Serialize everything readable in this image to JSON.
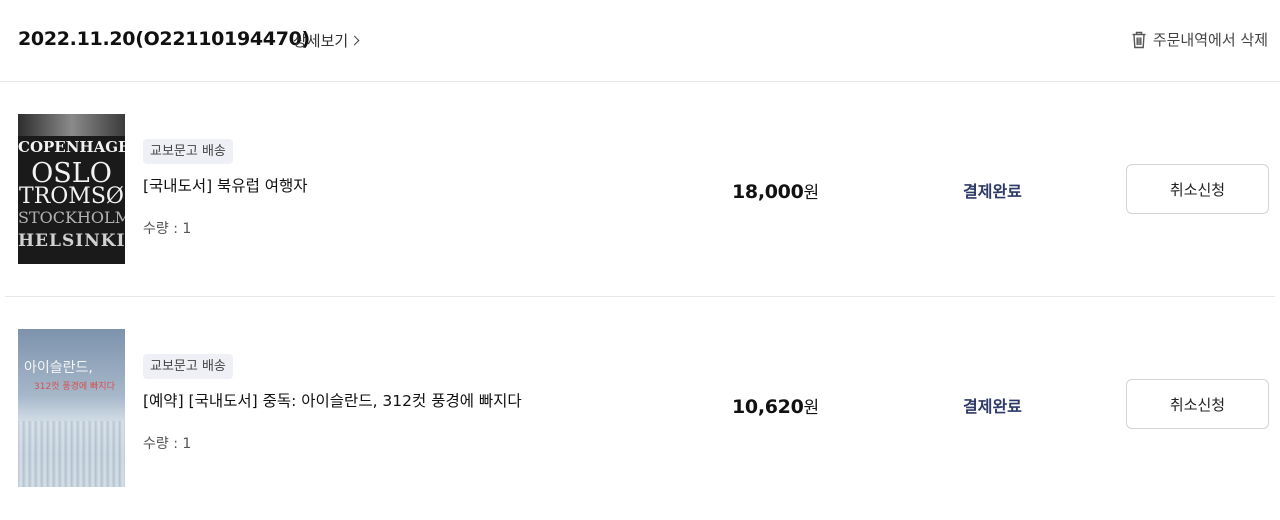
{
  "order": {
    "id_label": "2022.11.20(O22110194470)",
    "detail_link": "상세보기",
    "delete_label": "주문내역에서 삭제",
    "icons": {
      "detail_chevron": "chevron-right-icon",
      "delete": "trash-icon"
    }
  },
  "items": [
    {
      "badge": "교보문고 배송",
      "title": "[국내도서] 북유럽 여행자",
      "quantity": "수량 : 1",
      "price_number": "18,000",
      "price_unit": "원",
      "status": "결제완료",
      "cancel_label": "취소신청",
      "cover_text": [
        "COPENHAGEN",
        "OSLO",
        "TROMSØ",
        "STOCKHOLM",
        "HELSINKI"
      ]
    },
    {
      "badge": "교보문고 배송",
      "title": "[예약] [국내도서] 중독: 아이슬란드, 312컷 풍경에 빠지다",
      "quantity": "수량 : 1",
      "price_number": "10,620",
      "price_unit": "원",
      "status": "결제완료",
      "cancel_label": "취소신청",
      "cover_text": [
        "아이슬란드,",
        "312컷 풍경에 빠지다"
      ]
    }
  ],
  "colors": {
    "status": "#2e3a68",
    "badge_bg": "#eef0f5",
    "divider": "#e8e8e8"
  }
}
